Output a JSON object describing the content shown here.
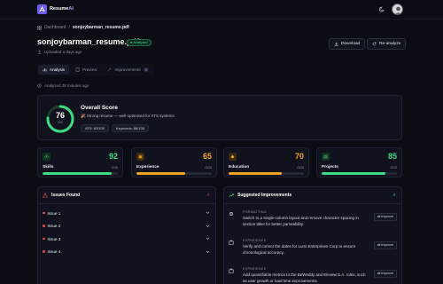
{
  "app": {
    "brand": "Resume",
    "brand_accent": "AI"
  },
  "breadcrumb": {
    "root": "Dashboard",
    "separator": "/",
    "current": "sonjoybarman_resume.pdf"
  },
  "header": {
    "title": "sonjoybarman_resume.pdf",
    "status_badge": "Analyzed",
    "uploaded": "Uploaded 4 days ago",
    "download_label": "Download",
    "reanalyze_label": "Re-analyze"
  },
  "tabs": [
    {
      "label": "Analysis",
      "active": true
    },
    {
      "label": "Preview",
      "active": false
    },
    {
      "label": "Improvements",
      "count": "5",
      "active": false
    }
  ],
  "analyzed_time": "Analyzed 28 minutes ago",
  "overall": {
    "score": "76",
    "score_value": 76,
    "max_label": "/100",
    "title": "Overall Score",
    "description": "Strong resume — well-optimised for ATS systems",
    "ats_chip": "ATS: 62/100",
    "keywords_chip": "Keywords: 86/100"
  },
  "categories": [
    {
      "label": "Skills",
      "score": "92",
      "value": 92,
      "max": "/100",
      "color": "#3ddc84",
      "icon": "code-icon"
    },
    {
      "label": "Experience",
      "score": "65",
      "value": 65,
      "max": "/100",
      "color": "#f5a524",
      "icon": "briefcase-icon"
    },
    {
      "label": "Education",
      "score": "70",
      "value": 70,
      "max": "/100",
      "color": "#f5a524",
      "icon": "graduation-icon"
    },
    {
      "label": "Projects",
      "score": "85",
      "value": 85,
      "max": "/100",
      "color": "#3ddc84",
      "icon": "folder-icon"
    }
  ],
  "issues": {
    "title": "Issues Found",
    "count": "4",
    "items": [
      "Issue 1",
      "Issue 2",
      "Issue 3",
      "Issue 4"
    ]
  },
  "suggestions": {
    "title": "Suggested Improvements",
    "count": "4",
    "improve_label": "Improve",
    "items": [
      {
        "category": "FORMATTING",
        "text": "Switch to a single-column layout and remove character spacing in section titles for better parseability."
      },
      {
        "category": "EXPERIENCE",
        "text": "Verify and correct the dates for Lumi Enterprises Corp to ensure chronological accuracy."
      },
      {
        "category": "EXPERIENCE",
        "text": "Add quantifiable metrics to the BeWeddy and Elevew S.A. roles, such as user growth or load time improvements."
      }
    ]
  },
  "colors": {
    "accent": "#6d5df6",
    "good": "#3ddc84",
    "warn": "#f5a524",
    "danger": "#e04848"
  }
}
